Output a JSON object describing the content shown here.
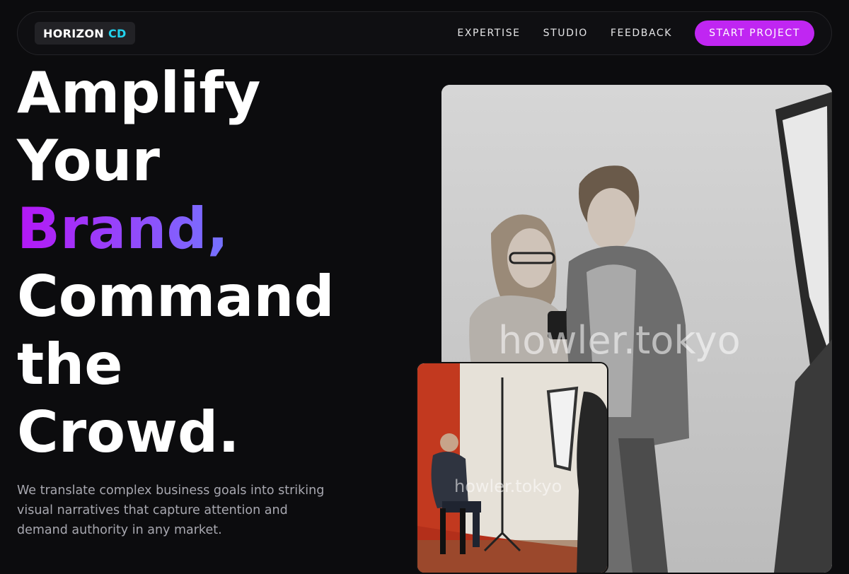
{
  "header": {
    "logo_main": "HORIZON",
    "logo_accent": "CD",
    "nav": [
      "EXPERTISE",
      "STUDIO",
      "FEEDBACK"
    ],
    "cta_label": "START PROJECT"
  },
  "hero": {
    "line1": "Amplify",
    "line2": "Your",
    "line3": "Brand,",
    "line4": "Command",
    "line5": "the",
    "line6": "Crowd.",
    "description": "We translate complex business goals into striking visual narratives that capture attention and demand authority in any market."
  },
  "images": {
    "main_watermark": "howler.tokyo",
    "inset_watermark": "howler.tokyo"
  },
  "colors": {
    "accent_magenta": "#c026f2",
    "accent_cyan": "#22d3ee",
    "background": "#0c0c0e"
  }
}
